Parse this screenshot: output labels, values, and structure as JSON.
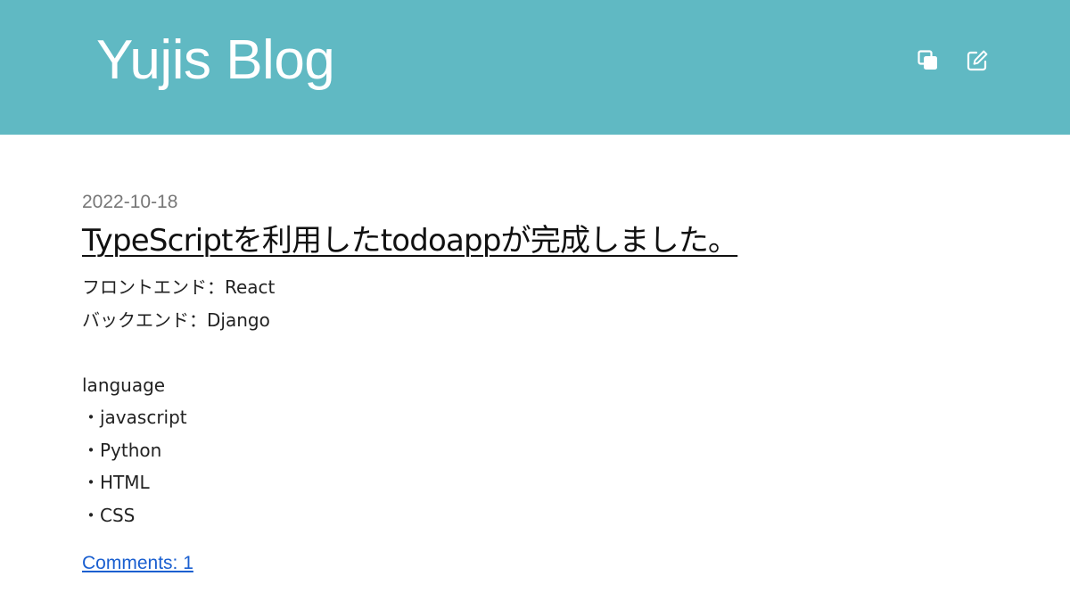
{
  "header": {
    "site_title": "Yujis Blog",
    "background_color": "#60b9c3",
    "icons": [
      {
        "name": "copy-icon",
        "color": "#ffffff"
      },
      {
        "name": "edit-icon",
        "color": "#ffffff"
      }
    ]
  },
  "post": {
    "date": "2022-10-18",
    "title": "TypeScriptを利用したtodoappが完成しました。",
    "body_lines": [
      "フロントエンド：React",
      "バックエンド：Django",
      "",
      "language",
      "・javascript",
      "・Python",
      "・HTML",
      "・CSS"
    ],
    "comments_link": "Comments: 1",
    "link_color": "#1a5fd0"
  }
}
